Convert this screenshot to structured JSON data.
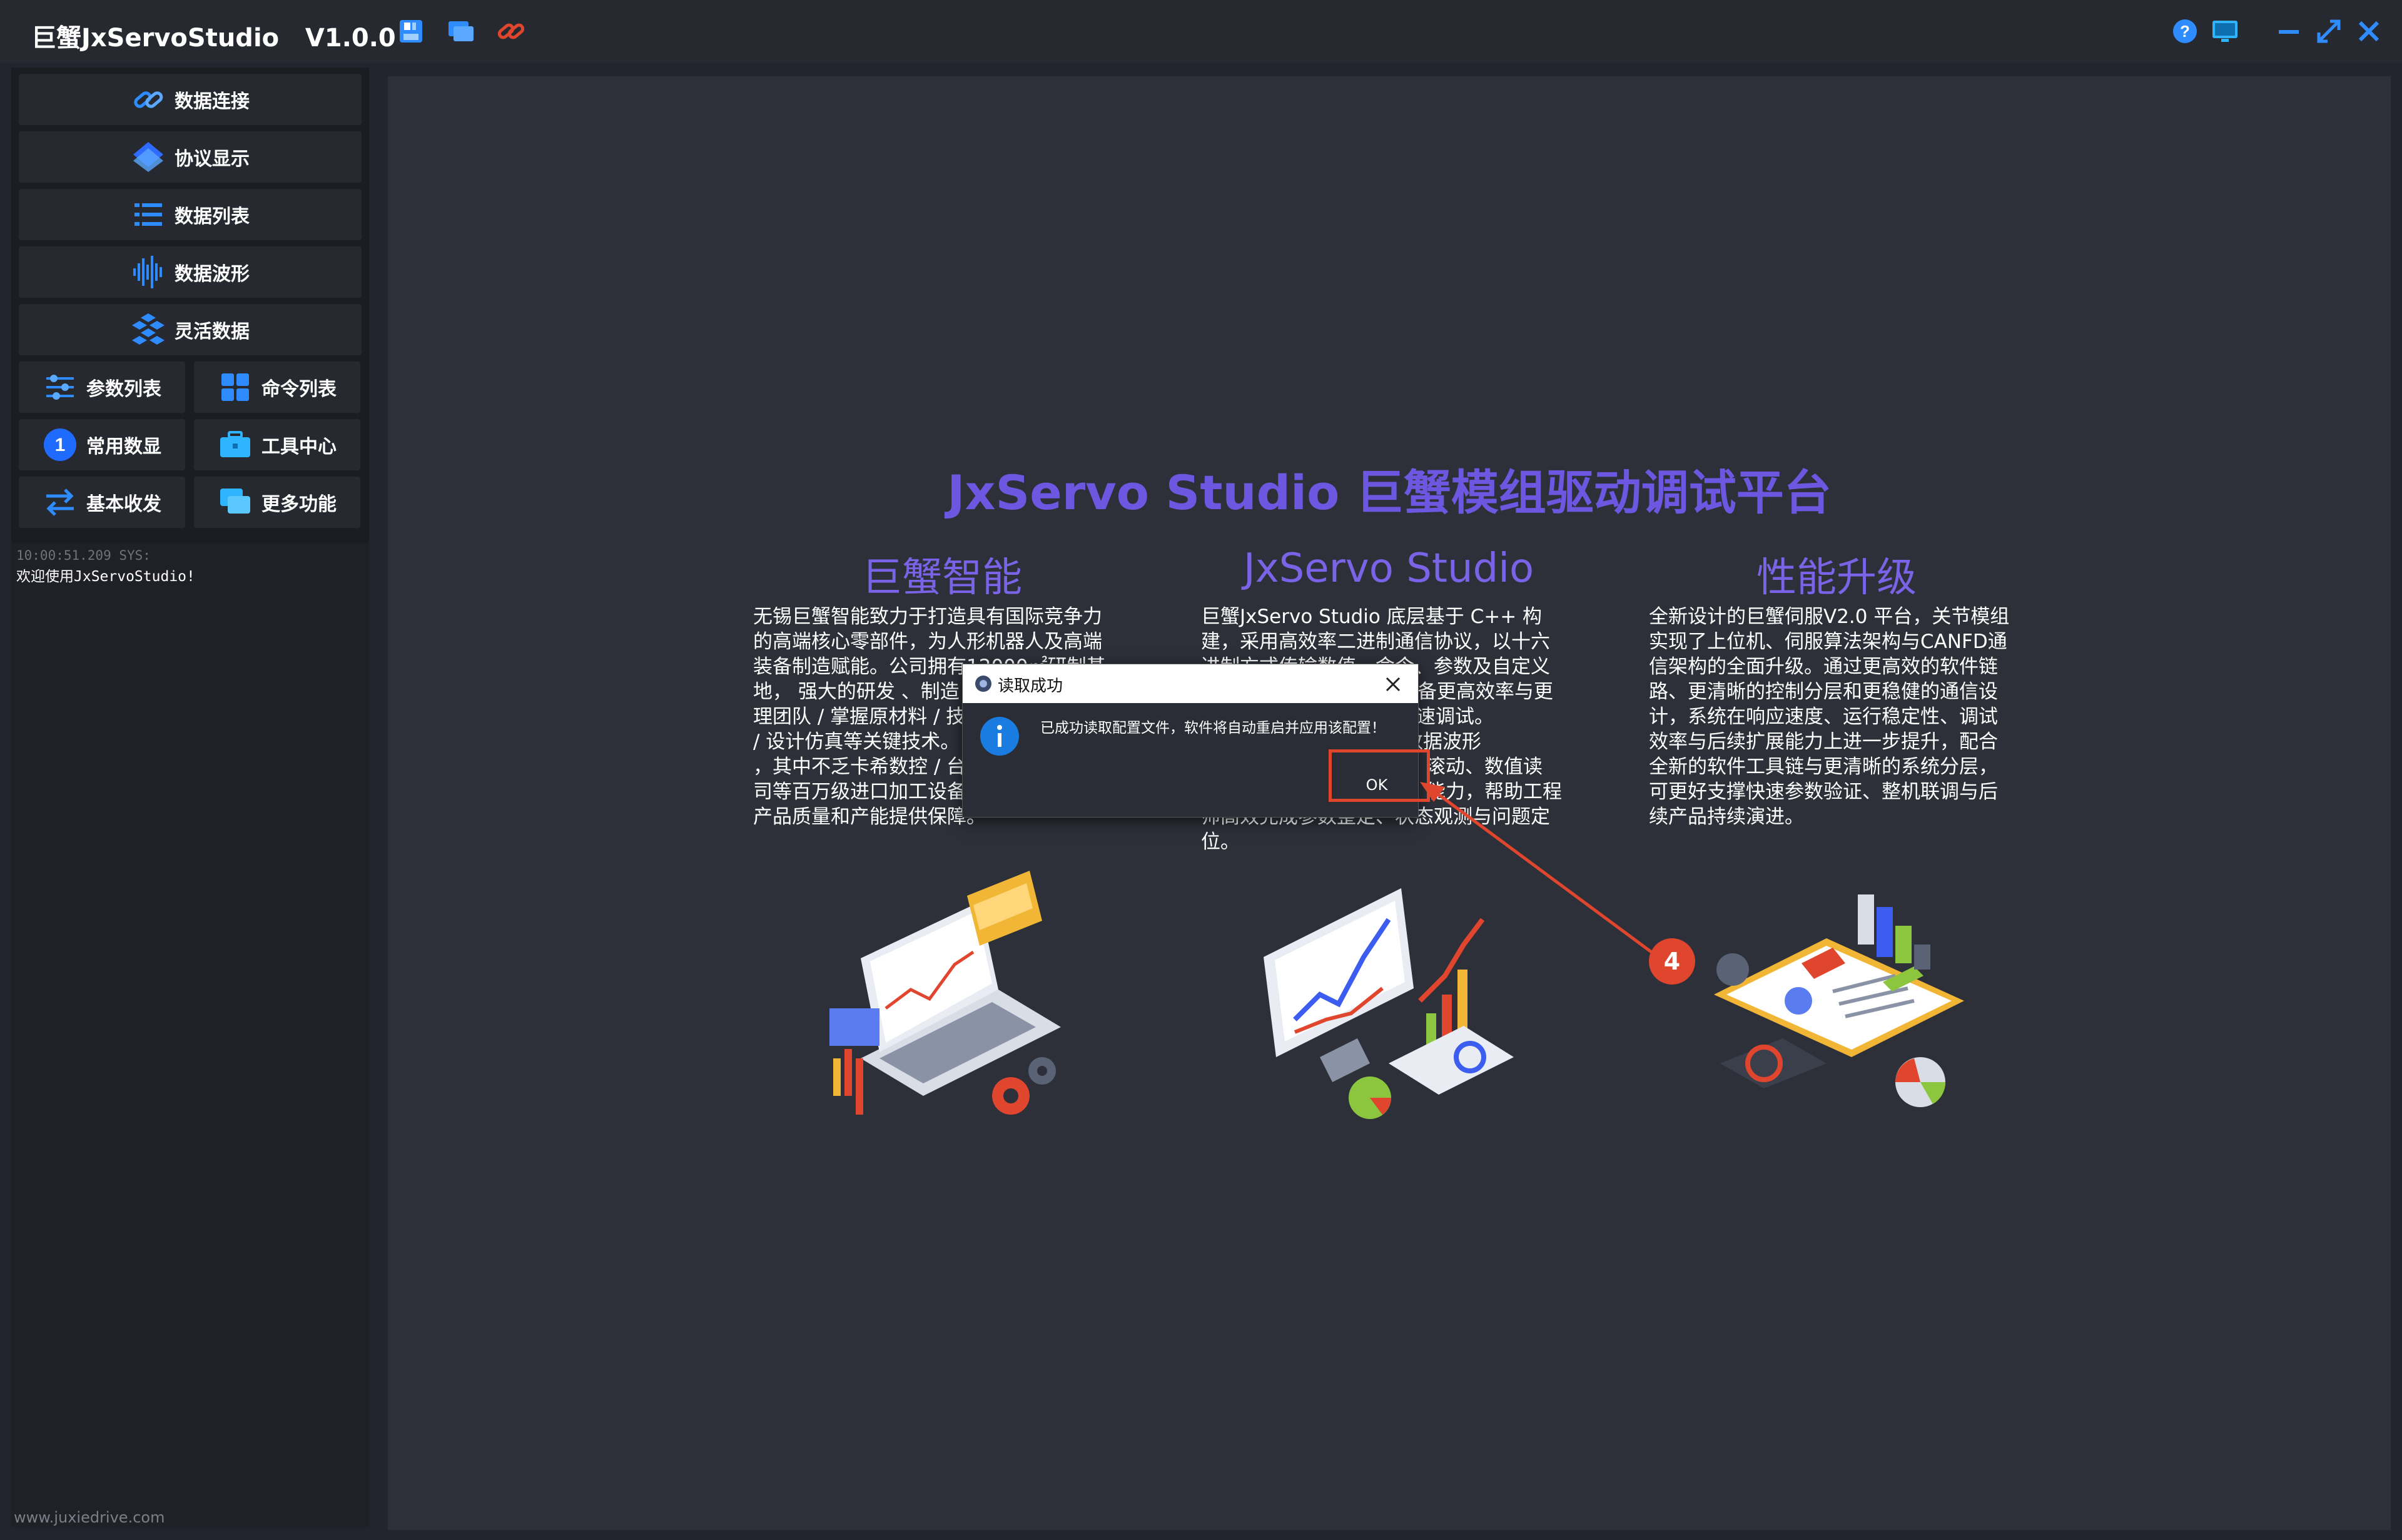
{
  "app": {
    "title": "巨蟹JxServoStudio",
    "version": "V1.0.0"
  },
  "toolbar": {
    "icons": [
      "save-icon",
      "window-icon",
      "link-icon"
    ],
    "right_icons": [
      "help-icon",
      "monitor-icon",
      "minimize-icon",
      "maximize-icon",
      "close-icon"
    ]
  },
  "sidebar": {
    "nav_full": [
      {
        "label": "数据连接",
        "icon": "link-icon"
      },
      {
        "label": "协议显示",
        "icon": "layers-icon"
      },
      {
        "label": "数据列表",
        "icon": "list-icon"
      },
      {
        "label": "数据波形",
        "icon": "waveform-icon"
      },
      {
        "label": "灵活数据",
        "icon": "cubes-icon"
      }
    ],
    "nav_half": [
      {
        "label": "参数列表",
        "icon": "sliders-icon"
      },
      {
        "label": "命令列表",
        "icon": "grid-icon"
      },
      {
        "label": "常用数显",
        "icon": "number-one-icon"
      },
      {
        "label": "工具中心",
        "icon": "toolbox-icon"
      },
      {
        "label": "基本收发",
        "icon": "swap-icon"
      },
      {
        "label": "更多功能",
        "icon": "chat-icon"
      }
    ],
    "log": {
      "time": "10:00:51.209 SYS:",
      "message": "欢迎使用JxServoStudio!"
    },
    "website": "www.juxiedrive.com"
  },
  "main": {
    "headline": "JxServo Studio 巨蟹模组驱动调试平台",
    "columns": [
      {
        "title": "巨蟹智能",
        "lines": [
          "无锡巨蟹智能致力于打造具有国际竞争力",
          "的高端核心零部件，为人形机器人及高端",
          "装备制造赋能。公司拥有12000㎡研制基",
          "地， 强大的研发 、制造",
          "理团队 / 掌握原材料 / 技",
          "/ 设计仿真等关键技术。",
          "，其中不乏卡希数控 / 台",
          "司等百万级进口加工设备",
          "产品质量和产能提供保障。"
        ]
      },
      {
        "title": "JxServo Studio",
        "lines": [
          "巨蟹JxServo Studio 底层基于 C++ 构",
          "建，采用高效率二进制通信协议，以十六",
          "进制方式传输数值、命令、参数及自定义",
          "数据，同时兼备更高效率与更",
          "级系统高速调试。",
          "高频率的数据波形",
          "滚动、数值读",
          "能力，帮助工程",
          "师高效完成参数整定、状态观测与问题定",
          "位。"
        ]
      },
      {
        "title": "性能升级",
        "lines": [
          "全新设计的巨蟹伺服V2.0 平台，关节模组",
          "实现了上位机、伺服算法架构与CANFD通",
          "信架构的全面升级。通过更高效的软件链",
          "路、更清晰的控制分层和更稳健的通信设",
          "计，系统在响应速度、运行稳定性、调试",
          "效率与后续扩展能力上进一步提升，配合",
          "全新的软件工具链与更清晰的系统分层，",
          "可更好支撑快速参数验证、整机联调与后",
          "续产品持续演进。"
        ]
      }
    ]
  },
  "dialog": {
    "title": "读取成功",
    "message": "已成功读取配置文件，软件将自动重启并应用该配置！",
    "ok_label": "OK",
    "icon": "info-icon"
  },
  "annotation": {
    "badge": "4",
    "color": "#e0452e"
  },
  "colors": {
    "accent": "#6e57e0",
    "icon_blue": "#2f8cff"
  }
}
